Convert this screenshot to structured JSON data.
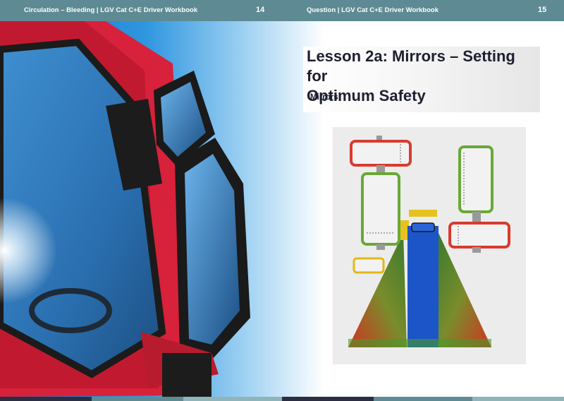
{
  "page_left": {
    "header_title": "Circulation – Bleeding | LGV Cat C+E Driver Workbook",
    "page_number": "14"
  },
  "page_right": {
    "header_title": "Question | LGV Cat C+E Driver Workbook",
    "page_number": "15",
    "lesson_title_line1": "Lesson 2a: Mirrors – Setting for",
    "lesson_title_line2": "Optimum Safety",
    "subheading": "Mirrors"
  },
  "colors": {
    "header_bg": "#5e8b93",
    "title_text": "#1e2030",
    "cab_red": "#d8213a",
    "sky_blue": "#1f86d6",
    "mirror_red": "#d83b2e",
    "mirror_green": "#6aa836",
    "mirror_yellow": "#e0b81a",
    "truck_blue": "#1c55c8"
  },
  "footer_colors": [
    "#2b2d42",
    "#5e8b93",
    "#8fb4ba",
    "#2b2d42",
    "#5e8b93",
    "#8fb4ba"
  ]
}
